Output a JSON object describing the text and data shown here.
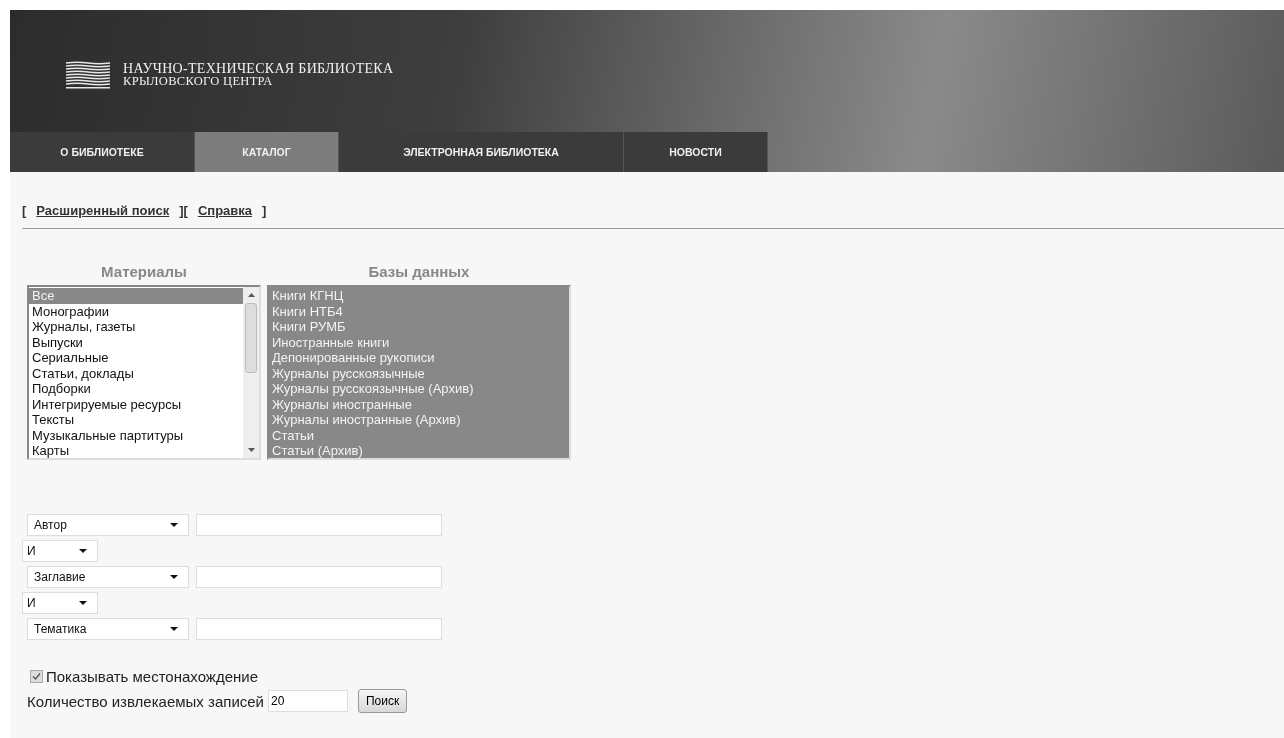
{
  "header": {
    "title_line_1": "НАУЧНО-ТЕХНИЧЕСКАЯ БИБЛИОТЕКА",
    "title_line_2": "КРЫЛОВСКОГО ЦЕНТРА"
  },
  "nav": [
    {
      "label": "О БИБЛИОТЕКЕ",
      "selected": false
    },
    {
      "label": "КАТАЛОГ",
      "selected": true
    },
    {
      "label": "ЭЛЕКТРОННАЯ БИБЛИОТЕКА",
      "selected": false
    },
    {
      "label": "НОВОСТИ",
      "selected": false
    }
  ],
  "link_bar": [
    {
      "kind": "bracket",
      "text": "["
    },
    {
      "kind": "link",
      "text": "Расширенный поиск"
    },
    {
      "kind": "bracket",
      "text": "]["
    },
    {
      "kind": "link",
      "text": "Справка"
    },
    {
      "kind": "bracket",
      "text": "]"
    }
  ],
  "materials": {
    "title": "Материалы",
    "items": [
      {
        "label": "Все",
        "selected": true
      },
      {
        "label": "Монографии",
        "selected": false
      },
      {
        "label": "Журналы, газеты",
        "selected": false
      },
      {
        "label": "Выпуски",
        "selected": false
      },
      {
        "label": "Сериальные",
        "selected": false
      },
      {
        "label": "Статьи, доклады",
        "selected": false
      },
      {
        "label": "Подборки",
        "selected": false
      },
      {
        "label": "Интегрируемые ресурсы",
        "selected": false
      },
      {
        "label": "Тексты",
        "selected": false
      },
      {
        "label": "Музыкальные партитуры",
        "selected": false
      },
      {
        "label": "Карты",
        "selected": false
      }
    ]
  },
  "databases": {
    "title": "Базы данных",
    "items": [
      {
        "label": "Книги КГНЦ",
        "selected": true
      },
      {
        "label": "Книги НТБ4",
        "selected": true
      },
      {
        "label": "Книги РУМБ",
        "selected": true
      },
      {
        "label": "Иностранные книги",
        "selected": true
      },
      {
        "label": "Депонированные рукописи",
        "selected": true
      },
      {
        "label": "Журналы русскоязычные",
        "selected": true
      },
      {
        "label": "Журналы русскоязычные (Архив)",
        "selected": true
      },
      {
        "label": "Журналы иностранные",
        "selected": true
      },
      {
        "label": "Журналы иностранные (Архив)",
        "selected": true
      },
      {
        "label": "Статьи",
        "selected": true
      },
      {
        "label": "Статьи (Архив)",
        "selected": true
      }
    ]
  },
  "search_rows": [
    {
      "kind": "field",
      "option": "Автор"
    },
    {
      "kind": "operator",
      "option": "И"
    },
    {
      "kind": "field",
      "option": "Заглавие"
    },
    {
      "kind": "operator",
      "option": "И"
    },
    {
      "kind": "field",
      "option": "Тематика"
    }
  ],
  "show_location": {
    "label": "Показывать местонахождение",
    "checked": true
  },
  "record_count": {
    "label": "Количество извлекаемых записей",
    "value": "20"
  },
  "search_button": "Поиск"
}
